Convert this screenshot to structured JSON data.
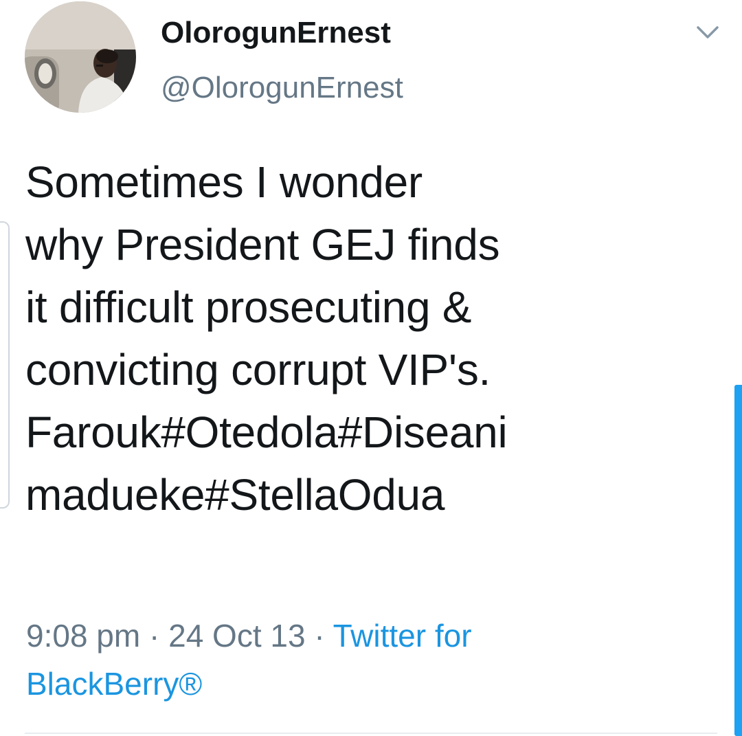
{
  "tweet": {
    "author": {
      "display_name": "OlorogunErnest",
      "handle": "@OlorogunErnest",
      "avatar_icon": "profile-photo"
    },
    "menu_icon": "chevron-down-icon",
    "text_lines": [
      "Sometimes I wonder",
      "why President GEJ finds",
      "it difficult prosecuting &",
      "convicting corrupt VIP's.",
      "Farouk#Otedola#Diseani",
      "madueke#StellaOdua"
    ],
    "meta": {
      "time": "9:08 pm",
      "separator": " · ",
      "date": "24 Oct 13",
      "source_part1": "Twitter for",
      "source_part2": "BlackBerry®"
    }
  },
  "colors": {
    "text": "#14171a",
    "secondary": "#657786",
    "link": "#1b95e0",
    "scrollbar": "#1da1f2",
    "divider": "#e6ecf0"
  }
}
